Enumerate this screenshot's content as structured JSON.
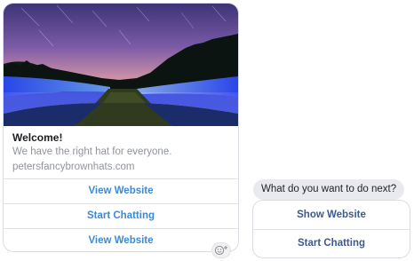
{
  "generic_card": {
    "image_alt": "",
    "title": "Welcome!",
    "subtitle": "We have the right hat for everyone.",
    "domain": "petersfancybrownhats.com",
    "buttons": [
      {
        "label": "View Website"
      },
      {
        "label": "Start Chatting"
      },
      {
        "label": "View Website"
      }
    ]
  },
  "reaction": {
    "icon": "add-reaction-icon"
  },
  "quick_reply": {
    "prompt": "What do you want to do next?",
    "buttons": [
      {
        "label": "Show Website"
      },
      {
        "label": "Start Chatting"
      }
    ]
  },
  "colors": {
    "card_button_text": "#3b8ad9",
    "quick_reply_text": "#3c5a8e",
    "bubble_bg": "#e9eaee",
    "border": "#d9dde3"
  }
}
